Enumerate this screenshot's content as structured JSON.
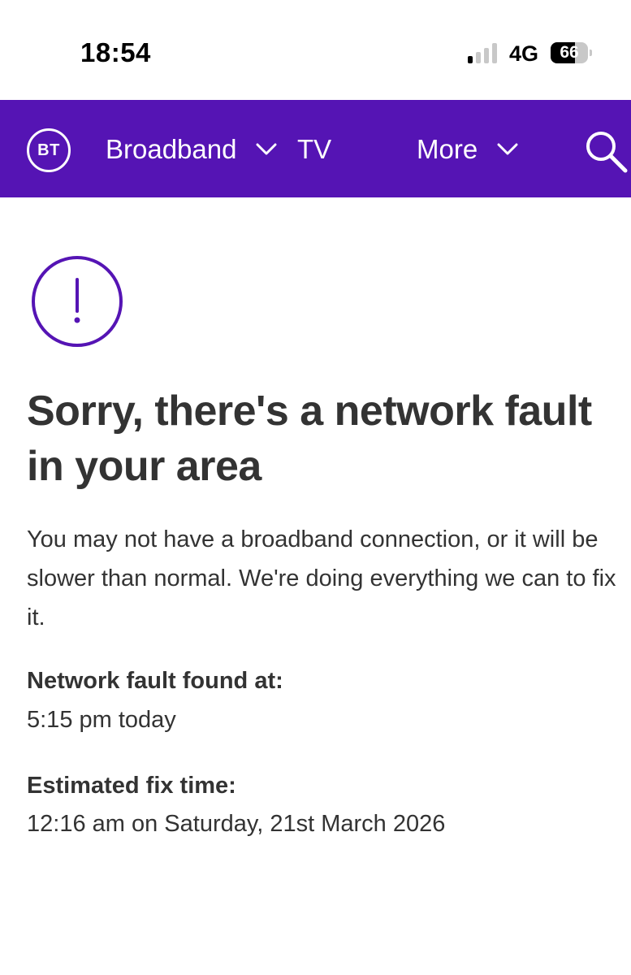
{
  "status_bar": {
    "time": "18:54",
    "network": "4G",
    "battery": "66",
    "battery_level": 0.66,
    "signal_bars_active": 1,
    "signal_bars_total": 4
  },
  "navbar": {
    "logo": "BT",
    "items": [
      {
        "label": "Broadband",
        "has_dropdown": true
      },
      {
        "label": "TV",
        "has_dropdown": false
      },
      {
        "label": "More",
        "has_dropdown": true
      }
    ],
    "search_icon": "search-icon",
    "background": "#5514b4"
  },
  "main": {
    "icon": "alert-circle-icon",
    "heading": "Sorry, there's a network fault in your area",
    "body": "You may not have a broadband connection, or it will be slower than normal. We're doing everything we can to fix it.",
    "fault_found_label": "Network fault found at:",
    "fault_found_value": "5:15 pm today",
    "fix_time_label": "Estimated fix time:",
    "fix_time_value": "12:16 am on Saturday, 21st March 2026",
    "accent": "#5514b4"
  }
}
